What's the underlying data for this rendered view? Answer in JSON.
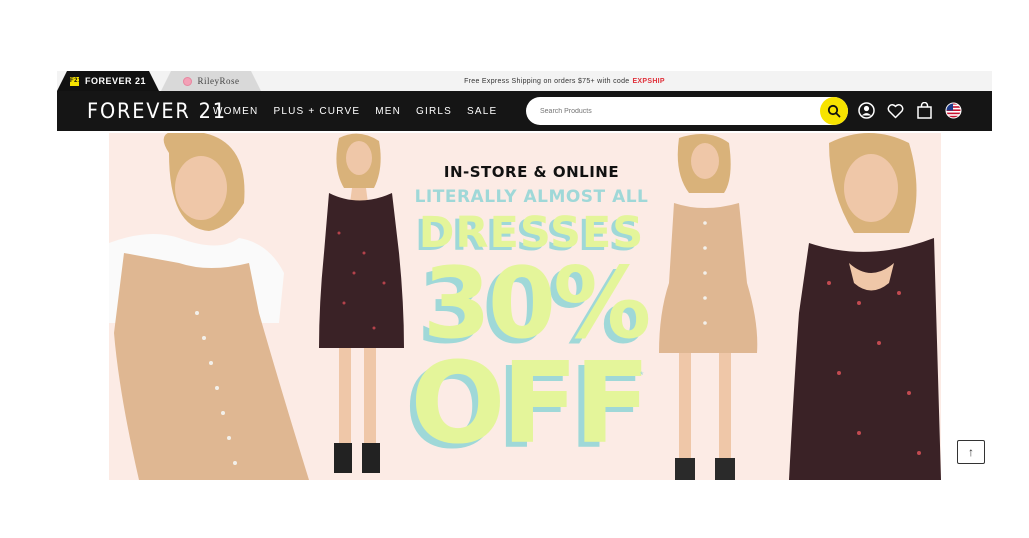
{
  "brand_tabs": {
    "forever21": {
      "label": "FOREVER 21",
      "badge": "F21"
    },
    "rileyrose": {
      "label": "RileyRose"
    }
  },
  "promo": {
    "text": "Free Express Shipping on orders $75+ with code",
    "code": "EXPSHIP",
    "code_color": "#e0303a"
  },
  "header": {
    "logo": "FOREVER 21",
    "nav": [
      "WOMEN",
      "PLUS + CURVE",
      "MEN",
      "GIRLS",
      "SALE"
    ],
    "search_placeholder": "Search Products",
    "icons": [
      "search-icon",
      "account-icon",
      "wishlist-heart-icon",
      "shopping-bag-icon",
      "us-flag-icon"
    ]
  },
  "hero": {
    "line1": "IN-STORE & ONLINE",
    "line2": "LITERALLY ALMOST ALL",
    "line3": "DRESSES",
    "line4": "30%",
    "line5": "OFF",
    "asterisk": "*",
    "colors": {
      "background": "#fcebe5",
      "accent_yellow": "#e4f59a",
      "accent_teal": "#9fd8d8"
    }
  },
  "back_to_top": {
    "label": "↑"
  }
}
